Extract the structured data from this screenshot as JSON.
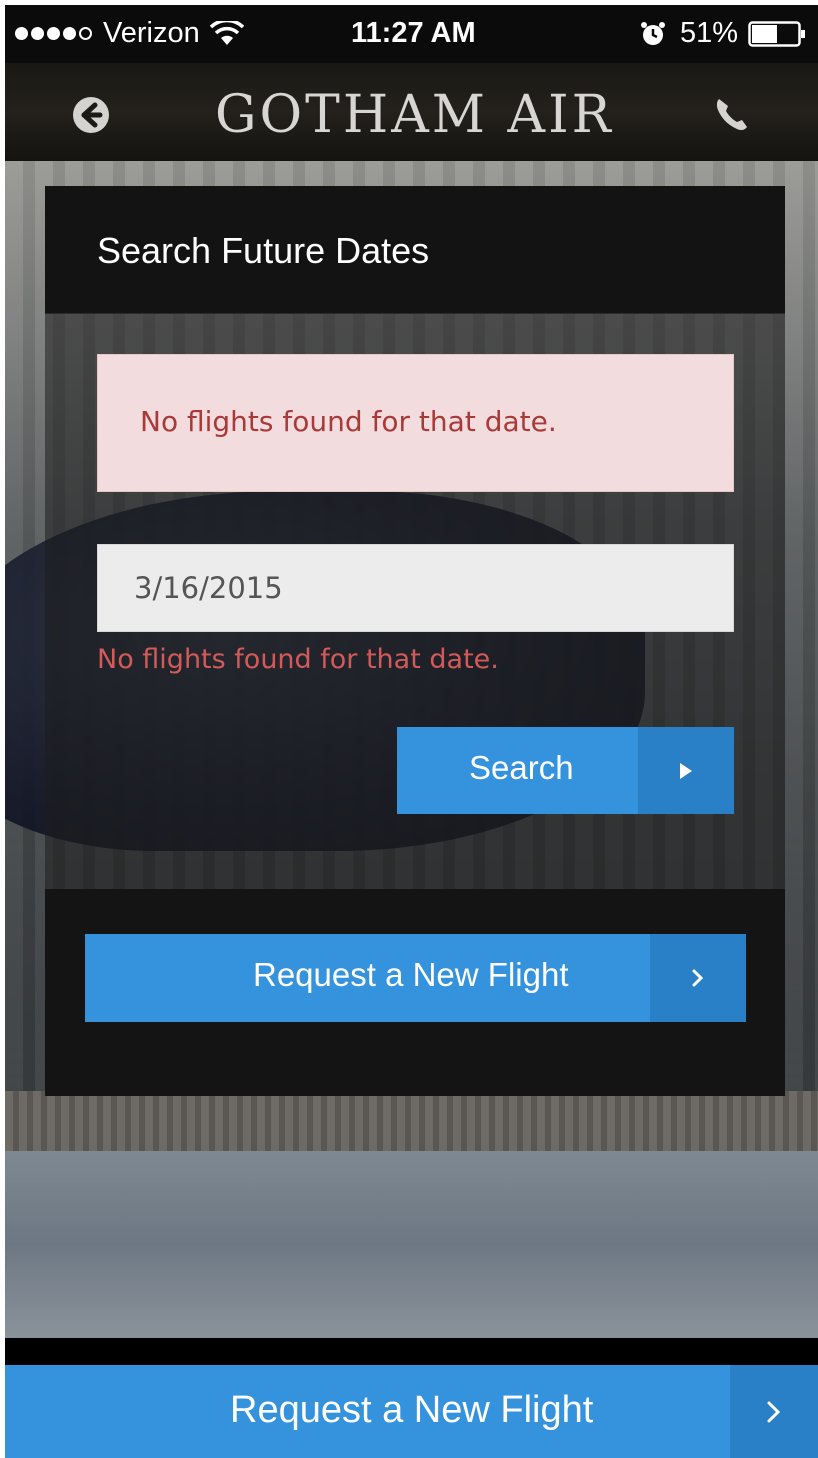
{
  "status_bar": {
    "carrier": "Verizon",
    "time": "11:27 AM",
    "battery": "51%",
    "signal_bars": 4,
    "icons": [
      "signal-dots-icon",
      "wifi-icon",
      "alarm-icon",
      "battery-icon"
    ]
  },
  "header": {
    "brand": "GOTHAM AIR",
    "back_icon": "back-arrow-icon",
    "phone_icon": "phone-icon"
  },
  "card": {
    "title": "Search Future Dates",
    "alert_message": "No flights found for that date.",
    "date_value": "3/16/2015",
    "field_error": "No flights found for that date.",
    "search_label": "Search",
    "search_icon": "play-arrow-icon",
    "request_label": "Request a New Flight",
    "request_icon": "chevron-right-icon"
  },
  "bottom_bar": {
    "request_label": "Request a New Flight",
    "request_icon": "chevron-right-icon"
  },
  "colors": {
    "accent": "#3493dc",
    "accent_dark": "#2a80c6",
    "alert_bg": "#f3dcdd",
    "alert_text": "#a83b3a",
    "error_text": "#d25a5a"
  }
}
